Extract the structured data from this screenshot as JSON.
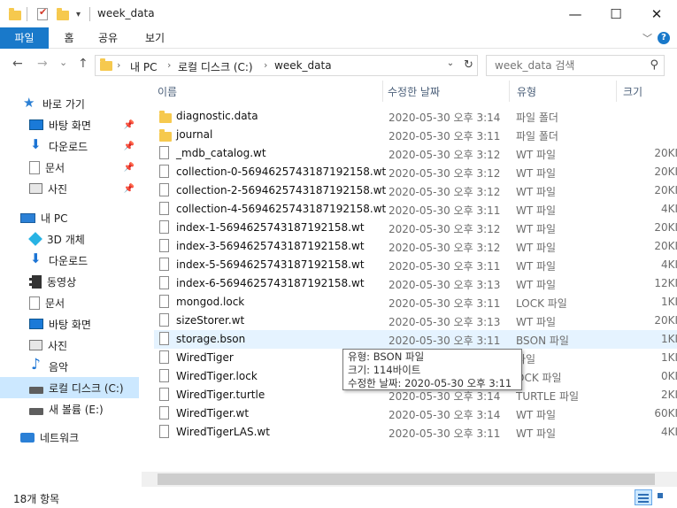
{
  "window": {
    "title": "week_data",
    "minimize_glyph": "—",
    "maximize_glyph": "☐",
    "close_glyph": "✕",
    "qat_dropdown_glyph": "▾"
  },
  "ribbon": {
    "tabs": [
      "파일",
      "홈",
      "공유",
      "보기"
    ],
    "active_tab": "파일",
    "collapse_glyph": "﹀",
    "help_glyph": "?"
  },
  "address": {
    "back_glyph": "←",
    "forward_glyph": "→",
    "recent_glyph": "⌄",
    "up_glyph": "↑",
    "separator_glyph": "›",
    "breadcrumbs": [
      "내 PC",
      "로컬 디스크 (C:)",
      "week_data"
    ],
    "dropdown_glyph": "⌄",
    "refresh_glyph": "↻",
    "search_placeholder": "week_data 검색",
    "search_glyph": "⚲"
  },
  "nav": {
    "items": [
      {
        "label": "바로 가기",
        "icon": "star-icon",
        "pinned": false
      },
      {
        "label": "바탕 화면",
        "icon": "desktop-icon",
        "pinned": true
      },
      {
        "label": "다운로드",
        "icon": "download-icon",
        "pinned": true
      },
      {
        "label": "문서",
        "icon": "document-icon",
        "pinned": true
      },
      {
        "label": "사진",
        "icon": "pictures-icon",
        "pinned": true
      },
      {
        "label": "내 PC",
        "icon": "pc-icon",
        "pinned": false
      },
      {
        "label": "3D 개체",
        "icon": "objects-3d-icon",
        "pinned": false
      },
      {
        "label": "다운로드",
        "icon": "download-icon",
        "pinned": false
      },
      {
        "label": "동영상",
        "icon": "video-icon",
        "pinned": false
      },
      {
        "label": "문서",
        "icon": "document-icon",
        "pinned": false
      },
      {
        "label": "바탕 화면",
        "icon": "desktop-icon",
        "pinned": false
      },
      {
        "label": "사진",
        "icon": "pictures-icon",
        "pinned": false
      },
      {
        "label": "음악",
        "icon": "music-icon",
        "pinned": false
      },
      {
        "label": "로컬 디스크 (C:)",
        "icon": "drive-icon",
        "pinned": false
      },
      {
        "label": "새 볼륨 (E:)",
        "icon": "drive-icon",
        "pinned": false
      },
      {
        "label": "네트워크",
        "icon": "network-icon",
        "pinned": false
      }
    ],
    "selected_item": "로컬 디스크 (C:)",
    "pin_glyph": "📌"
  },
  "columns": {
    "name": "이름",
    "date": "수정한 날짜",
    "type": "유형",
    "size": "크기",
    "sort_glyph": "^"
  },
  "files": [
    {
      "name": "diagnostic.data",
      "date": "2020-05-30 오후 3:14",
      "type": "파일 폴더",
      "size": "",
      "kind": "folder"
    },
    {
      "name": "journal",
      "date": "2020-05-30 오후 3:11",
      "type": "파일 폴더",
      "size": "",
      "kind": "folder"
    },
    {
      "name": "_mdb_catalog.wt",
      "date": "2020-05-30 오후 3:12",
      "type": "WT 파일",
      "size": "20KI",
      "kind": "file"
    },
    {
      "name": "collection-0-5694625743187192158.wt",
      "date": "2020-05-30 오후 3:12",
      "type": "WT 파일",
      "size": "20KI",
      "kind": "file"
    },
    {
      "name": "collection-2-5694625743187192158.wt",
      "date": "2020-05-30 오후 3:12",
      "type": "WT 파일",
      "size": "20KI",
      "kind": "file"
    },
    {
      "name": "collection-4-5694625743187192158.wt",
      "date": "2020-05-30 오후 3:11",
      "type": "WT 파일",
      "size": "4KI",
      "kind": "file"
    },
    {
      "name": "index-1-5694625743187192158.wt",
      "date": "2020-05-30 오후 3:12",
      "type": "WT 파일",
      "size": "20KI",
      "kind": "file"
    },
    {
      "name": "index-3-5694625743187192158.wt",
      "date": "2020-05-30 오후 3:12",
      "type": "WT 파일",
      "size": "20KI",
      "kind": "file"
    },
    {
      "name": "index-5-5694625743187192158.wt",
      "date": "2020-05-30 오후 3:11",
      "type": "WT 파일",
      "size": "4KI",
      "kind": "file"
    },
    {
      "name": "index-6-5694625743187192158.wt",
      "date": "2020-05-30 오후 3:13",
      "type": "WT 파일",
      "size": "12KI",
      "kind": "file"
    },
    {
      "name": "mongod.lock",
      "date": "2020-05-30 오후 3:11",
      "type": "LOCK 파일",
      "size": "1KI",
      "kind": "file"
    },
    {
      "name": "sizeStorer.wt",
      "date": "2020-05-30 오후 3:13",
      "type": "WT 파일",
      "size": "20KI",
      "kind": "file"
    },
    {
      "name": "storage.bson",
      "date": "2020-05-30 오후 3:11",
      "type": "BSON 파일",
      "size": "1KI",
      "kind": "file"
    },
    {
      "name": "WiredTiger",
      "date": "",
      "type": "파일",
      "size": "1KI",
      "kind": "file"
    },
    {
      "name": "WiredTiger.lock",
      "date": "",
      "type": "OCK 파일",
      "size": "0KI",
      "kind": "file"
    },
    {
      "name": "WiredTiger.turtle",
      "date": "2020-05-30 오후 3:14",
      "type": "TURTLE 파일",
      "size": "2KI",
      "kind": "file"
    },
    {
      "name": "WiredTiger.wt",
      "date": "2020-05-30 오후 3:14",
      "type": "WT 파일",
      "size": "60KI",
      "kind": "file"
    },
    {
      "name": "WiredTigerLAS.wt",
      "date": "2020-05-30 오후 3:11",
      "type": "WT 파일",
      "size": "4KI",
      "kind": "file"
    }
  ],
  "hovered_file": "storage.bson",
  "tooltip": {
    "type_line": "유형: BSON 파일",
    "size_line": "크기: 114바이트",
    "date_line": "수정한 날짜: 2020-05-30 오후 3:11"
  },
  "status": {
    "item_count": "18개 항목"
  },
  "colors": {
    "accent": "#1979ca",
    "selection": "#cce8ff",
    "hover": "#e5f3ff",
    "folder": "#f6c94e"
  }
}
